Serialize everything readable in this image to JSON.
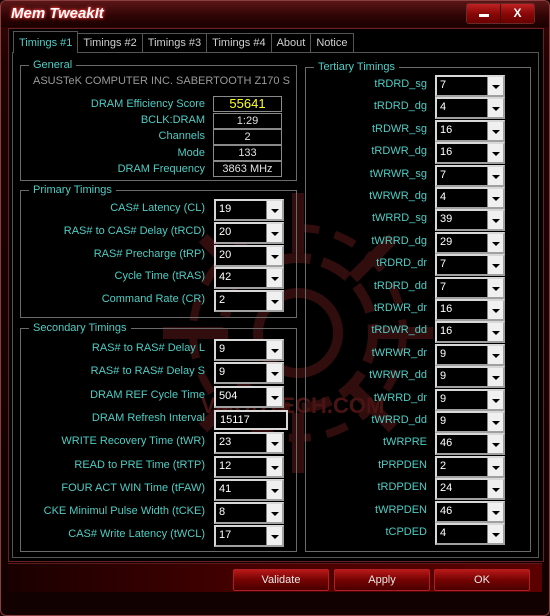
{
  "window": {
    "title": "Mem TweakIt",
    "minimize_label": "",
    "close_label": "X"
  },
  "tabs": [
    {
      "label": "Timings #1",
      "active": true
    },
    {
      "label": "Timings #2"
    },
    {
      "label": "Timings #3"
    },
    {
      "label": "Timings #4"
    },
    {
      "label": "About"
    },
    {
      "label": "Notice"
    }
  ],
  "general": {
    "legend": "General",
    "board": "ASUSTeK COMPUTER INC. SABERTOOTH Z170 S",
    "rows": [
      {
        "label": "DRAM Efficiency Score",
        "value": "55641"
      },
      {
        "label": "BCLK:DRAM",
        "value": "1:29"
      },
      {
        "label": "Channels",
        "value": "2"
      },
      {
        "label": "Mode",
        "value": "133"
      },
      {
        "label": "DRAM Frequency",
        "value": "3863 MHz"
      }
    ]
  },
  "primary": {
    "legend": "Primary Timings",
    "rows": [
      {
        "label": "CAS# Latency (CL)",
        "value": "19"
      },
      {
        "label": "RAS# to CAS# Delay (tRCD)",
        "value": "20"
      },
      {
        "label": "RAS# Precharge (tRP)",
        "value": "20"
      },
      {
        "label": "Cycle Time (tRAS)",
        "value": "42"
      },
      {
        "label": "Command Rate (CR)",
        "value": "2"
      }
    ]
  },
  "secondary": {
    "legend": "Secondary Timings",
    "rows": [
      {
        "label": "RAS# to RAS# Delay L",
        "value": "9"
      },
      {
        "label": "RAS# to RAS# Delay S",
        "value": "9"
      },
      {
        "label": "DRAM REF Cycle Time",
        "value": "504"
      },
      {
        "label": "DRAM Refresh Interval",
        "value": "15117"
      },
      {
        "label": "WRITE Recovery Time (tWR)",
        "value": "23"
      },
      {
        "label": "READ to PRE Time (tRTP)",
        "value": "12"
      },
      {
        "label": "FOUR ACT WIN Time (tFAW)",
        "value": "41"
      },
      {
        "label": "CKE Minimul Pulse Width (tCKE)",
        "value": "8"
      },
      {
        "label": "CAS# Write Latency (tWCL)",
        "value": "17"
      }
    ]
  },
  "tertiary": {
    "legend": "Tertiary Timings",
    "rows": [
      {
        "label": "tRDRD_sg",
        "value": "7"
      },
      {
        "label": "tRDRD_dg",
        "value": "4"
      },
      {
        "label": "tRDWR_sg",
        "value": "16"
      },
      {
        "label": "tRDWR_dg",
        "value": "16"
      },
      {
        "label": "tWRWR_sg",
        "value": "7"
      },
      {
        "label": "tWRWR_dg",
        "value": "4"
      },
      {
        "label": "tWRRD_sg",
        "value": "39"
      },
      {
        "label": "tWRRD_dg",
        "value": "29"
      },
      {
        "label": "tRDRD_dr",
        "value": "7"
      },
      {
        "label": "tRDRD_dd",
        "value": "7"
      },
      {
        "label": "tRDWR_dr",
        "value": "16"
      },
      {
        "label": "tRDWR_dd",
        "value": "16"
      },
      {
        "label": "tWRWR_dr",
        "value": "9"
      },
      {
        "label": "tWRWR_dd",
        "value": "9"
      },
      {
        "label": "tWRRD_dr",
        "value": "9"
      },
      {
        "label": "tWRRD_dd",
        "value": "9"
      },
      {
        "label": "tWRPRE",
        "value": "46"
      },
      {
        "label": "tPRPDEN",
        "value": "2"
      },
      {
        "label": "tRDPDEN",
        "value": "24"
      },
      {
        "label": "tWRPDEN",
        "value": "46"
      },
      {
        "label": "tCPDED",
        "value": "4"
      }
    ]
  },
  "watermark": "VMODTECH.COM",
  "buttons": {
    "validate": "Validate",
    "apply": "Apply",
    "ok": "OK"
  },
  "colors": {
    "accent_text": "#4ecdc4",
    "score_text": "#ffff20",
    "button_red": "#b81818"
  }
}
